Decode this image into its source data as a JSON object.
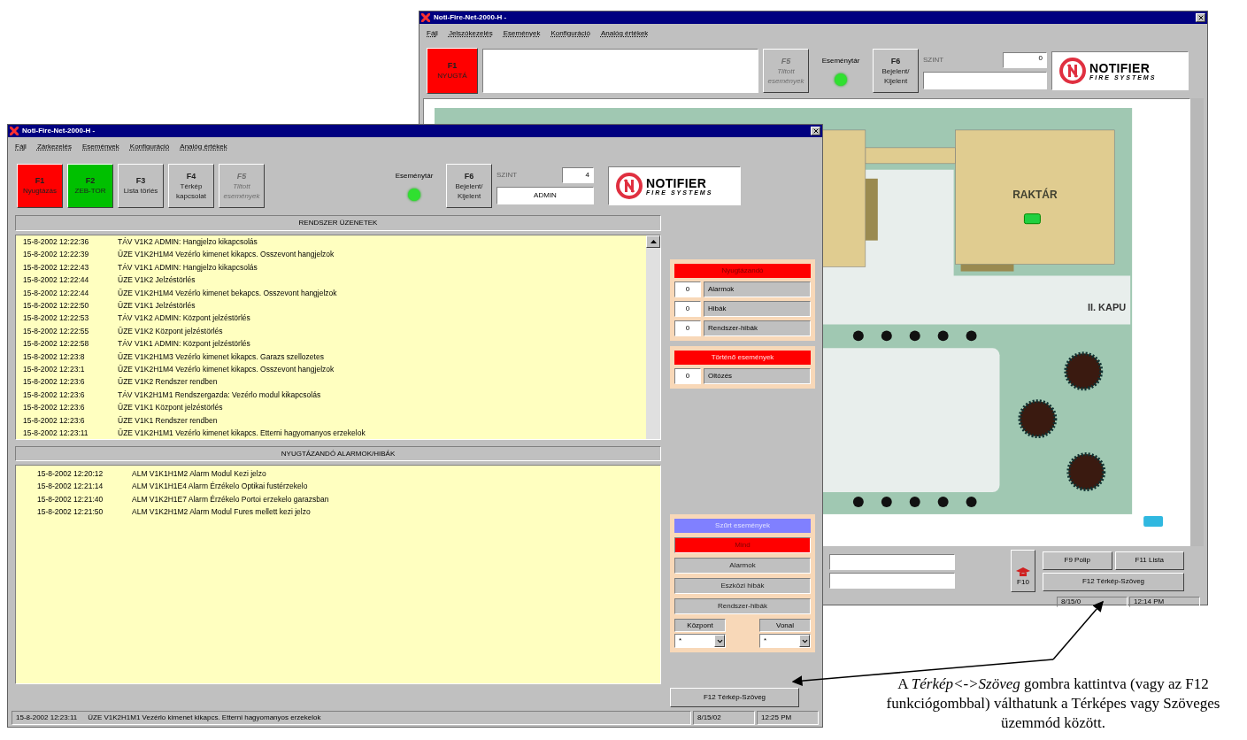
{
  "back_window": {
    "title": "Noti-Fire-Net-2000-H -",
    "menu": [
      "Fájl",
      "Jelszókezelés",
      "Események",
      "Konfiguráció",
      "Analóg értékek"
    ],
    "left_keys": [
      {
        "key": "F1",
        "label": "NYUGTÁ",
        "color": "#ff0000",
        "disabled": false
      }
    ],
    "right_keys": [
      {
        "key": "F5",
        "label": "Tiltott események",
        "color": "#c0c0c0",
        "disabled": true
      }
    ],
    "event_store": {
      "label": "Eseménytár",
      "led_on": true
    },
    "login_key": {
      "key": "F6",
      "label": "Bejelent/ Kijelent",
      "color": "#c0c0c0",
      "disabled": false
    },
    "level": {
      "label": "SZINT",
      "value": "0"
    },
    "logo": {
      "name": "NOTIFIER",
      "tagline": "FIRE SYSTEMS"
    },
    "map": {
      "building_label": "RAKTÁR",
      "gate_label": "II. KAPU"
    },
    "f10_label": "F10",
    "bottom_buttons": [
      "F9 Polip",
      "F11 Lista",
      "F12 Térkép-Szöveg"
    ],
    "status": {
      "date": "8/15/0",
      "time": "12:14 PM"
    }
  },
  "front_window": {
    "title": "Noti-Fire-Net-2000-H -",
    "menu": [
      "Fájl",
      "Zárkezelés",
      "Események",
      "Konfiguráció",
      "Analóg értékek"
    ],
    "keys": [
      {
        "key": "F1",
        "label": "Nyugtázás",
        "color": "#ff0000",
        "disabled": false
      },
      {
        "key": "F2",
        "label": "ZEB-TOR",
        "color": "#00c000",
        "disabled": false
      },
      {
        "key": "F3",
        "label": "Lista törlés",
        "color": "#c0c0c0",
        "disabled": false
      },
      {
        "key": "F4",
        "label": "Térkép kapcsolat",
        "color": "#c0c0c0",
        "disabled": false
      },
      {
        "key": "F5",
        "label": "Tiltott események",
        "color": "#c0c0c0",
        "disabled": true
      }
    ],
    "event_store": {
      "label": "Eseménytár",
      "led_on": true
    },
    "login_key": {
      "key": "F6",
      "label": "Bejelent/ Kijelent",
      "color": "#c0c0c0",
      "disabled": false
    },
    "level": {
      "label": "SZINT",
      "value": "4",
      "user": "ADMIN"
    },
    "logo": {
      "name": "NOTIFIER",
      "tagline": "FIRE SYSTEMS"
    },
    "messages": {
      "title": "RENDSZER ÜZENETEK",
      "rows": [
        {
          "time": "15-8-2002 12:22:36",
          "text": "TÁV V1K2 ADMIN: Hangjelzo kikapcsolás"
        },
        {
          "time": "15-8-2002 12:22:39",
          "text": "ÜZE V1K2H1M4 Vezérlo kimenet kikapcs. Osszevont hangjelzok"
        },
        {
          "time": "15-8-2002 12:22:43",
          "text": "TÁV V1K1 ADMIN: Hangjelzo kikapcsolás"
        },
        {
          "time": "15-8-2002 12:22:44",
          "text": "ÜZE V1K2 Jelzéstörlés"
        },
        {
          "time": "15-8-2002 12:22:44",
          "text": "ÜZE V1K2H1M4 Vezérlo kimenet bekapcs. Osszevont hangjelzok"
        },
        {
          "time": "15-8-2002 12:22:50",
          "text": "ÜZE V1K1 Jelzéstörlés"
        },
        {
          "time": "15-8-2002 12:22:53",
          "text": "TÁV V1K2 ADMIN: Központ jelzéstörlés"
        },
        {
          "time": "15-8-2002 12:22:55",
          "text": "ÜZE V1K2 Központ jelzéstörlés"
        },
        {
          "time": "15-8-2002 12:22:58",
          "text": "TÁV V1K1 ADMIN: Központ jelzéstörlés"
        },
        {
          "time": "15-8-2002 12:23:8",
          "text": "ÜZE V1K2H1M3 Vezérlo kimenet kikapcs. Garazs szellozetes"
        },
        {
          "time": "15-8-2002 12:23:1",
          "text": "ÜZE V1K2H1M4 Vezérlo kimenet kikapcs. Osszevont hangjelzok"
        },
        {
          "time": "15-8-2002 12:23:6",
          "text": "ÜZE V1K2 Rendszer rendben"
        },
        {
          "time": "15-8-2002 12:23:6",
          "text": "TÁV V1K2H1M1 Rendszergazda: Vezérlo modul kikapcsolás"
        },
        {
          "time": "15-8-2002 12:23:6",
          "text": "ÜZE V1K1 Központ jelzéstörlés"
        },
        {
          "time": "15-8-2002 12:23:6",
          "text": "ÜZE V1K1 Rendszer rendben"
        },
        {
          "time": "15-8-2002 12:23:11",
          "text": "ÜZE V1K2H1M1 Vezérlo kimenet kikapcs. Etterni hagyomanyos erzekelok"
        }
      ]
    },
    "alarms": {
      "title": "NYUGTÁZANDÓ ALARMOK/HIBÁK",
      "rows": [
        {
          "time": "15-8-2002 12:20:12",
          "text": "ALM V1K1H1M2 Alarm Modul Kezi jelzo"
        },
        {
          "time": "15-8-2002 12:21:14",
          "text": "ALM V1K1H1E4 Alarm Érzékelo Optikai fustérzekelo"
        },
        {
          "time": "15-8-2002 12:21:40",
          "text": "ALM V1K2H1E7 Alarm Érzékelo Portoi erzekelo garazsban"
        },
        {
          "time": "15-8-2002 12:21:50",
          "text": "ALM V1K2H1M2 Alarm Modul Fures mellett kezi jelzo"
        }
      ]
    },
    "pending": {
      "title": "Nyugtázandó",
      "counts": [
        {
          "count": "0",
          "label": "Alarmok"
        },
        {
          "count": "0",
          "label": "Hibák"
        },
        {
          "count": "0",
          "label": "Rendszer-hibák"
        }
      ]
    },
    "ongoing": {
      "title": "Történő események",
      "counts": [
        {
          "count": "0",
          "label": "Oltózés"
        }
      ]
    },
    "filter": {
      "title": "Szűrt események",
      "items": [
        {
          "label": "Mind",
          "selected": true
        },
        {
          "label": "Alarmok",
          "selected": false
        },
        {
          "label": "Eszközi hibák",
          "selected": false
        },
        {
          "label": "Rendszer-hibák",
          "selected": false
        }
      ],
      "selects": [
        {
          "label": "Központ",
          "value": "*"
        },
        {
          "label": "Vonal",
          "value": "*"
        }
      ]
    },
    "toggle_button": "F12 Térkép-Szöveg",
    "status": {
      "time": "15-8-2002 12:23:11",
      "message": "ÜZE V1K2H1M1 Vezérlo kimenet kikapcs. Etterni hagyomanyos erzekelok",
      "date": "8/15/02",
      "clock": "12:25 PM"
    }
  },
  "caption": "A *Térkép<->Szöveg* gombra kattintva (vagy az F12 funkciógombbal) válthatunk a Térképes vagy Szöveges üzemmód között."
}
